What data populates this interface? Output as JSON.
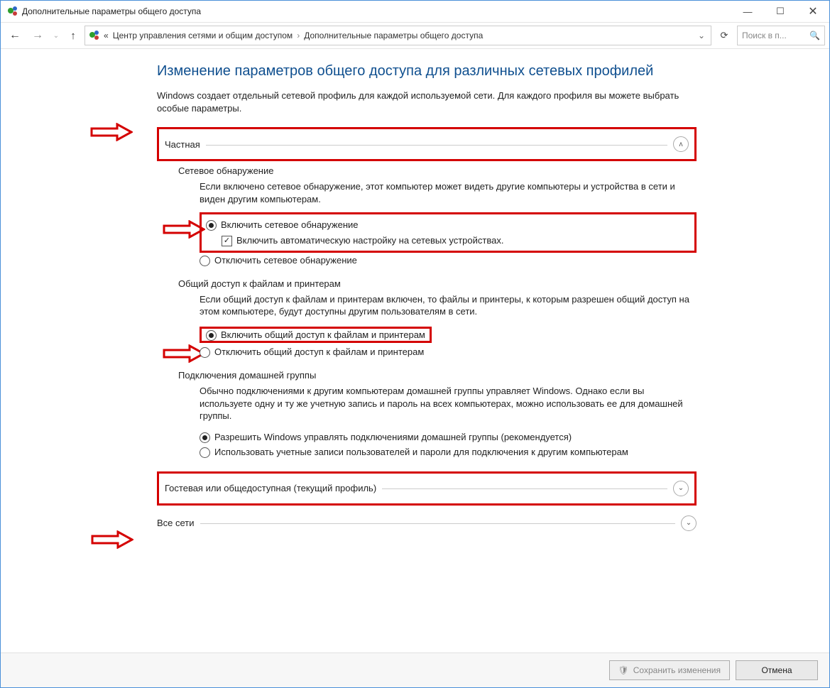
{
  "window": {
    "title": "Дополнительные параметры общего доступа"
  },
  "breadcrumbs": {
    "root_glyph": "«",
    "item1": "Центр управления сетями и общим доступом",
    "item2": "Дополнительные параметры общего доступа"
  },
  "search": {
    "placeholder": "Поиск в п..."
  },
  "page": {
    "title": "Изменение параметров общего доступа для различных сетевых профилей",
    "subtitle": "Windows создает отдельный сетевой профиль для каждой используемой сети. Для каждого профиля вы можете выбрать особые параметры."
  },
  "sections": {
    "private": {
      "label": "Частная",
      "expanded": true,
      "network_discovery": {
        "title": "Сетевое обнаружение",
        "desc": "Если включено сетевое обнаружение, этот компьютер может видеть другие компьютеры и устройства в сети и виден другим компьютерам.",
        "radio_on": "Включить сетевое обнаружение",
        "check_auto": "Включить автоматическую настройку на сетевых устройствах.",
        "radio_off": "Отключить сетевое обнаружение"
      },
      "file_share": {
        "title": "Общий доступ к файлам и принтерам",
        "desc": "Если общий доступ к файлам и принтерам включен, то файлы и принтеры, к которым разрешен общий доступ на этом компьютере, будут доступны другим пользователям в сети.",
        "radio_on": "Включить общий доступ к файлам и принтерам",
        "radio_off": "Отключить общий доступ к файлам и принтерам"
      },
      "homegroup": {
        "title": "Подключения домашней группы",
        "desc": "Обычно подключениями к другим компьютерам домашней группы управляет Windows. Однако если вы используете одну и ту же учетную запись и пароль на всех компьютерах, можно использовать ее для домашней группы.",
        "radio_win": "Разрешить Windows управлять подключениями домашней группы (рекомендуется)",
        "radio_user": "Использовать учетные записи пользователей и пароли для подключения к другим компьютерам"
      }
    },
    "guest": {
      "label": "Гостевая или общедоступная (текущий профиль)",
      "expanded": false
    },
    "all": {
      "label": "Все сети",
      "expanded": false
    }
  },
  "footer": {
    "save": "Сохранить изменения",
    "cancel": "Отмена"
  }
}
